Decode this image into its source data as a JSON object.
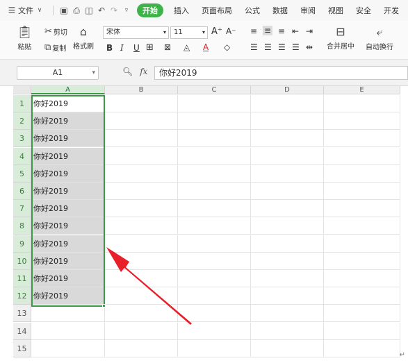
{
  "menu": {
    "file_label": "文件",
    "start_tab": "开始",
    "tabs": [
      "插入",
      "页面布局",
      "公式",
      "数据",
      "审阅",
      "视图",
      "安全",
      "开发"
    ]
  },
  "ribbon": {
    "paste": "粘贴",
    "cut": "剪切",
    "copy": "复制",
    "format_painter": "格式刷",
    "font_name": "宋体",
    "font_size": "11",
    "bold": "B",
    "italic": "I",
    "underline": "U",
    "merge_center": "合并居中",
    "wrap_text": "自动换行"
  },
  "formula_bar": {
    "cell_ref": "A1",
    "fx_label": "fx",
    "content": "你好2019"
  },
  "sheet": {
    "columns": [
      "A",
      "B",
      "C",
      "D",
      "E"
    ],
    "rows": [
      "1",
      "2",
      "3",
      "4",
      "5",
      "6",
      "7",
      "8",
      "9",
      "10",
      "11",
      "12",
      "13",
      "14",
      "15"
    ],
    "column_a_values": [
      "你好2019",
      "你好2019",
      "你好2019",
      "你好2019",
      "你好2019",
      "你好2019",
      "你好2019",
      "你好2019",
      "你好2019",
      "你好2019",
      "你好2019",
      "你好2019"
    ],
    "selected_range": "A1:A12",
    "accent_color": "#3c9a46",
    "annotation_arrow_color": "#e8202a"
  }
}
